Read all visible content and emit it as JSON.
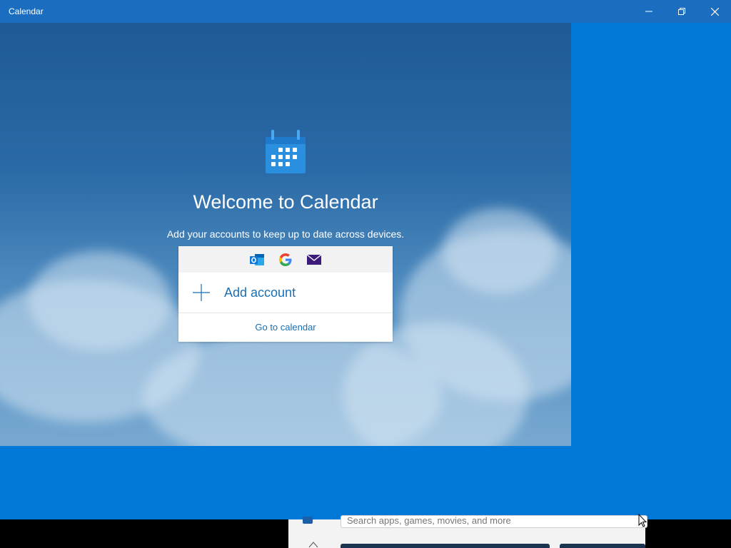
{
  "window": {
    "title": "Calendar",
    "controls": [
      "minimize-icon",
      "restore-icon",
      "close-icon"
    ]
  },
  "welcome": {
    "heading": "Welcome to Calendar",
    "subtext": "Add your accounts to keep up to date across devices."
  },
  "account_card": {
    "providers": [
      "outlook-icon",
      "google-icon",
      "mail-icon"
    ],
    "add_account_label": "Add account",
    "go_to_calendar_label": "Go to calendar"
  },
  "background_app": {
    "search_placeholder": "Search apps, games, movies, and more"
  },
  "colors": {
    "accent": "#0078d7",
    "link": "#1a6fb3",
    "titlebar": "#1a6dbf"
  }
}
